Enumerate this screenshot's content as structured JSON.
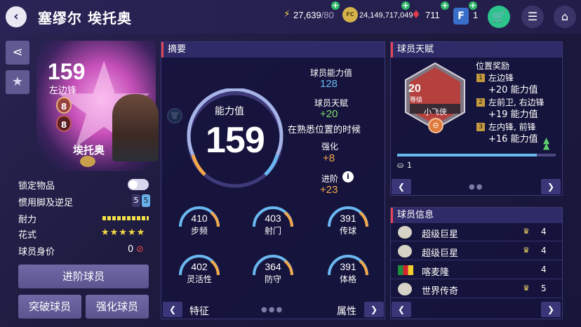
{
  "header": {
    "title": "塞缪尔 埃托奥",
    "energy": "27,639",
    "energy_max": "/80",
    "coins": "24,149,717,049",
    "gems": "711",
    "f_count": "1",
    "f_label": "F"
  },
  "card": {
    "ovr": "159",
    "position": "左边锋",
    "badge1": "8",
    "badge2": "8",
    "name": "埃托奥"
  },
  "left": {
    "lock_label": "锁定物品",
    "foot_label": "惯用脚及逆足",
    "foot_left": "5",
    "foot_right": "5",
    "stamina_label": "耐力",
    "skill_label": "花式",
    "skill_stars": "★★★★★",
    "value_label": "球员身价",
    "value": "0",
    "btn_upgrade": "进阶球员",
    "btn_break": "突破球员",
    "btn_enhance": "强化球员"
  },
  "summary": {
    "title": "摘要",
    "ovr_label": "能力值",
    "ovr": "159",
    "base_label": "球员能力值",
    "base": "128",
    "talent_label": "球员天赋",
    "talent": "+20",
    "talent_note": "在熟悉位置的时候",
    "enhance_label": "强化",
    "enhance": "+8",
    "advance_label": "进阶",
    "advance": "+23",
    "stats": [
      {
        "label": "步频",
        "value": "410"
      },
      {
        "label": "射门",
        "value": "403"
      },
      {
        "label": "传球",
        "value": "391"
      },
      {
        "label": "灵活性",
        "value": "402"
      },
      {
        "label": "防守",
        "value": "364"
      },
      {
        "label": "体格",
        "value": "391"
      }
    ],
    "footer_left": "特征",
    "footer_right": "属性"
  },
  "talent_panel": {
    "title": "球员天赋",
    "level": "20",
    "level_unit": "等级",
    "talent_name": "小飞侠",
    "bonus_title": "位置奖励",
    "bonuses": [
      {
        "rank": "1",
        "pos": "左边锋",
        "val": "+20 能力值"
      },
      {
        "rank": "2",
        "pos": "左前卫, 右边锋",
        "val": "+19 能力值"
      },
      {
        "rank": "3",
        "pos": "左内锋, 前锋",
        "val": "+16 能力值"
      }
    ],
    "count": "1",
    "progress": 0.88
  },
  "info_panel": {
    "title": "球员信息",
    "rows": [
      {
        "label": "超级巨星",
        "num": "4",
        "crown": true
      },
      {
        "label": "超级巨星",
        "num": "4",
        "crown": true
      },
      {
        "label": "喀麦隆",
        "num": "4",
        "crown": false
      },
      {
        "label": "世界传奇",
        "num": "5",
        "crown": true
      }
    ]
  },
  "colors": {
    "accent_red": "#e34656",
    "stat_blue": "#6ab8f0",
    "stat_green": "#7fdc6a",
    "stat_orange": "#f4a84a",
    "cart_green": "#2cc38c"
  }
}
